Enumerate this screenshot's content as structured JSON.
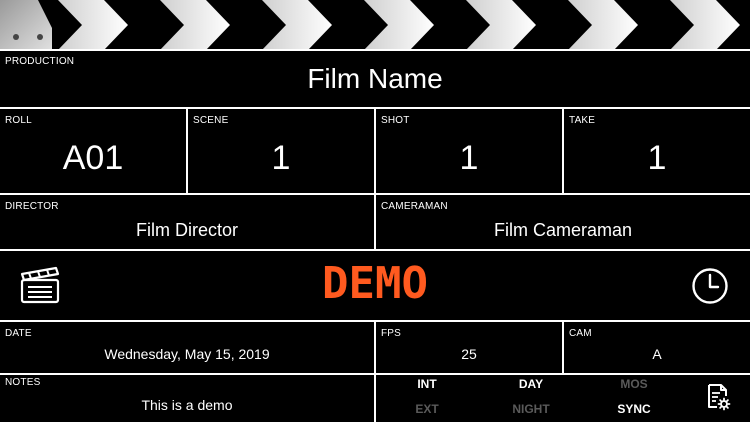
{
  "production": {
    "label": "PRODUCTION",
    "value": "Film Name"
  },
  "roll": {
    "label": "ROLL",
    "value": "A01"
  },
  "scene": {
    "label": "SCENE",
    "value": "1"
  },
  "shot": {
    "label": "SHOT",
    "value": "1"
  },
  "take": {
    "label": "TAKE",
    "value": "1"
  },
  "director": {
    "label": "DIRECTOR",
    "value": "Film Director"
  },
  "cameraman": {
    "label": "CAMERAMAN",
    "value": "Film Cameraman"
  },
  "banner": {
    "text": "DEMO",
    "color": "#FF5A1F"
  },
  "date": {
    "label": "DATE",
    "value": "Wednesday, May 15, 2019"
  },
  "fps": {
    "label": "FPS",
    "value": "25"
  },
  "cam": {
    "label": "CAM",
    "value": "A"
  },
  "notes": {
    "label": "NOTES",
    "value": "This is a demo"
  },
  "options": {
    "int": {
      "label": "INT",
      "active": true
    },
    "day": {
      "label": "DAY",
      "active": true
    },
    "mos": {
      "label": "MOS",
      "active": false
    },
    "ext": {
      "label": "EXT",
      "active": false
    },
    "night": {
      "label": "NIGHT",
      "active": false
    },
    "sync": {
      "label": "SYNC",
      "active": true
    }
  },
  "icons": {
    "left": "clapperboard-icon",
    "right": "clock-icon",
    "settings": "document-settings-icon"
  }
}
